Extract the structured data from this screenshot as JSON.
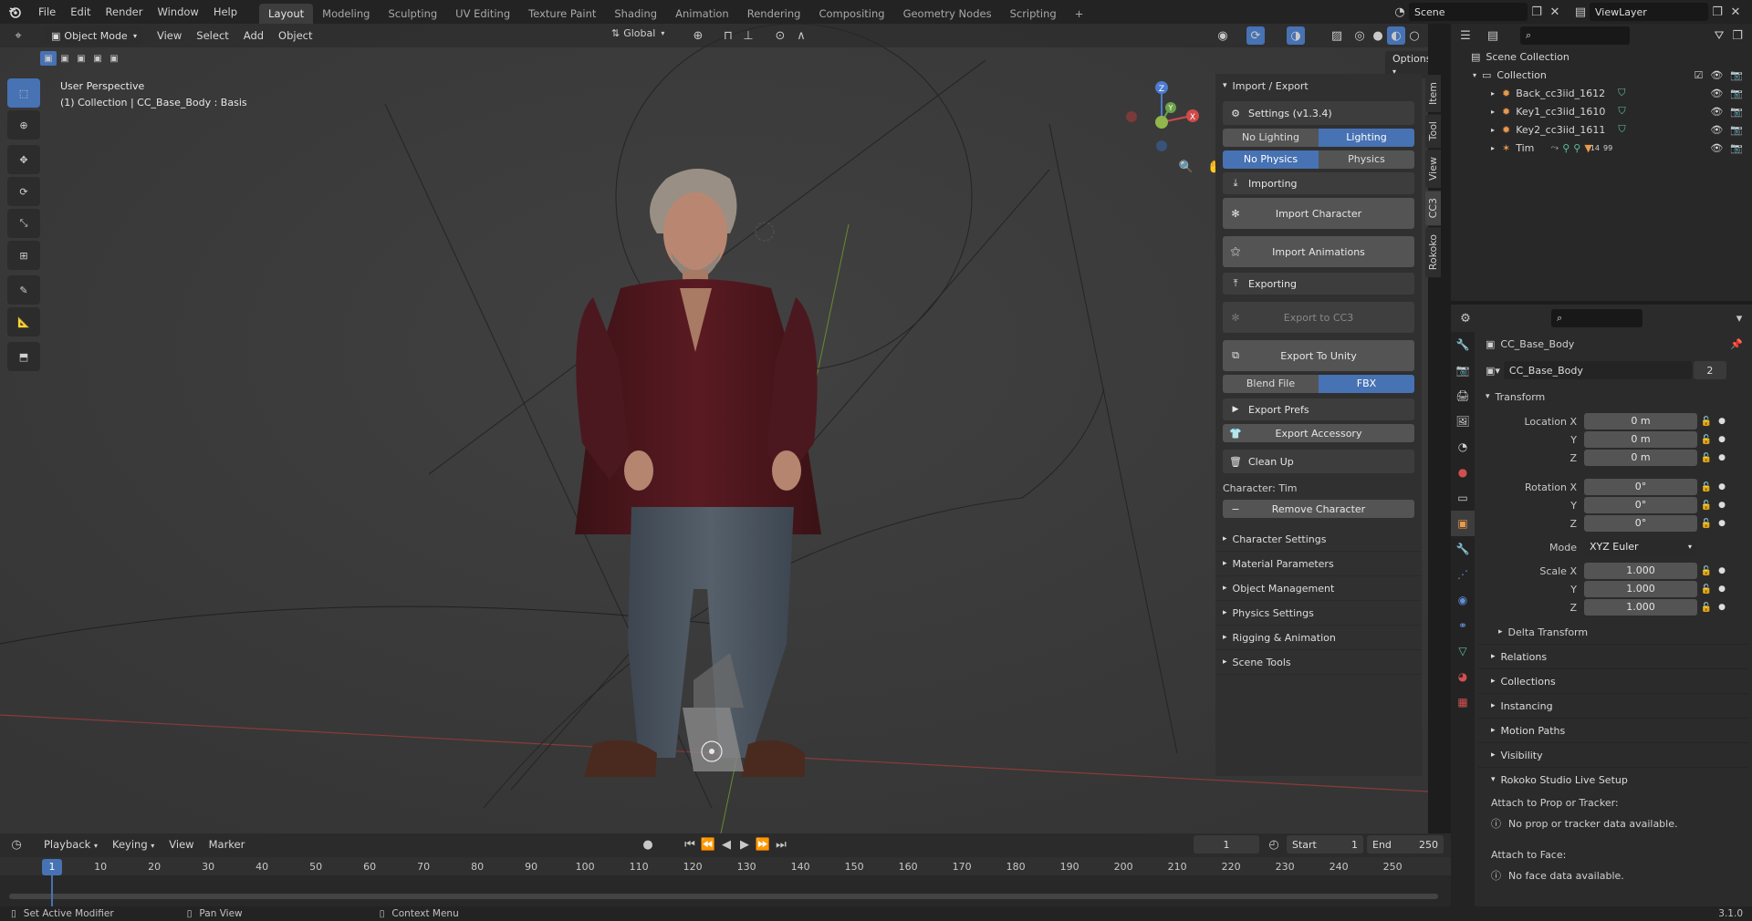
{
  "topbar": {
    "menus": [
      "File",
      "Edit",
      "Render",
      "Window",
      "Help"
    ],
    "workspaces": [
      "Layout",
      "Modeling",
      "Sculpting",
      "UV Editing",
      "Texture Paint",
      "Shading",
      "Animation",
      "Rendering",
      "Compositing",
      "Geometry Nodes",
      "Scripting"
    ],
    "active_workspace": "Layout",
    "add_tab": "+",
    "scene": "Scene",
    "view_layer": "ViewLayer"
  },
  "viewport": {
    "mode": "Object Mode",
    "menus": [
      "View",
      "Select",
      "Add",
      "Object"
    ],
    "transform_orientation": "Global",
    "options": "Options",
    "overlay_title": "User Perspective",
    "overlay_sub": "(1) Collection | CC_Base_Body : Basis",
    "gizmo": {
      "x": "X",
      "y": "Y",
      "z": "Z"
    }
  },
  "npanel": {
    "title": "Import / Export",
    "settings": "Settings  (v1.3.4)",
    "lighting_seg": [
      "No Lighting",
      "Lighting"
    ],
    "physics_seg": [
      "No Physics",
      "Physics"
    ],
    "importing": "Importing",
    "import_character": "Import Character",
    "import_animations": "Import Animations",
    "exporting": "Exporting",
    "export_cc3": "Export to CC3",
    "export_unity": "Export To Unity",
    "format_seg": [
      "Blend File",
      "FBX"
    ],
    "export_prefs": "Export Prefs",
    "export_accessory": "Export Accessory",
    "clean_up": "Clean Up",
    "character": "Character: Tim",
    "remove_character": "Remove Character",
    "sections": [
      "Character Settings",
      "Material Parameters",
      "Object Management",
      "Physics Settings",
      "Rigging & Animation",
      "Scene Tools"
    ],
    "tabs": [
      "Item",
      "Tool",
      "View",
      "CC3",
      "Rokoko"
    ]
  },
  "outliner": {
    "scene_collection": "Scene Collection",
    "collection": "Collection",
    "items": [
      {
        "name": "Back_cc3iid_1612"
      },
      {
        "name": "Key1_cc3iid_1610"
      },
      {
        "name": "Key2_cc3iid_1611"
      },
      {
        "name": "Tim",
        "extra": "14",
        "extra2": "99"
      }
    ]
  },
  "properties": {
    "object_name": "CC_Base_Body",
    "data_name": "CC_Base_Body",
    "users": "2",
    "transform": "Transform",
    "location": {
      "label": "Location X",
      "x": "0 m",
      "y": "0 m",
      "z": "0 m"
    },
    "rotation": {
      "label": "Rotation X",
      "x": "0°",
      "y": "0°",
      "z": "0°"
    },
    "mode_label": "Mode",
    "mode_value": "XYZ Euler",
    "scale": {
      "label": "Scale X",
      "x": "1.000",
      "y": "1.000",
      "z": "1.000"
    },
    "axis_y": "Y",
    "axis_z": "Z",
    "delta": "Delta Transform",
    "sections": [
      "Relations",
      "Collections",
      "Instancing",
      "Motion Paths",
      "Visibility"
    ],
    "rokoko": "Rokoko Studio Live Setup",
    "attach_prop": "Attach to Prop or Tracker:",
    "no_prop": "No prop or tracker data available.",
    "attach_face": "Attach to Face:",
    "no_face": "No face data available."
  },
  "timeline": {
    "menus": [
      "Playback",
      "Keying",
      "View",
      "Marker"
    ],
    "current_frame": "1",
    "start_label": "Start",
    "start": "1",
    "end_label": "End",
    "end": "250",
    "ticks": [
      "1",
      "10",
      "20",
      "30",
      "40",
      "50",
      "60",
      "70",
      "80",
      "90",
      "100",
      "110",
      "120",
      "130",
      "140",
      "150",
      "160",
      "170",
      "180",
      "190",
      "200",
      "210",
      "220",
      "230",
      "240",
      "250"
    ]
  },
  "statusbar": {
    "left": "Set Active Modifier",
    "middle": "Pan View",
    "right": "Context Menu",
    "version": "3.1.0"
  }
}
